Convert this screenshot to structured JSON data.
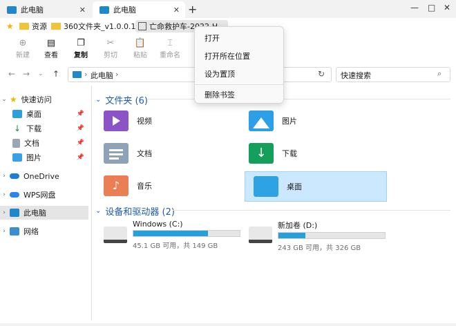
{
  "colors": {
    "accent": "#0067c0",
    "selection_bg": "#cce8ff",
    "drive_bar": "#26a0da",
    "section_text": "#1e5bb0"
  },
  "tabs": [
    {
      "label": "此电脑",
      "icon": "monitor-icon",
      "active": false
    },
    {
      "label": "此电脑",
      "icon": "monitor-icon",
      "active": true
    }
  ],
  "new_tab_label": "+",
  "window_controls": {
    "minimize": "—",
    "maximize": "□",
    "close": "✕"
  },
  "bookmarks": [
    {
      "label": "资源",
      "icon": "folder-icon"
    },
    {
      "label": "360文件夹_v1.0.0.1...",
      "icon": "folder-icon"
    },
    {
      "label": "亡命救护车-2022-H...",
      "icon": "video-file-icon"
    }
  ],
  "toolbar": {
    "new": "新建",
    "view": "查看",
    "copy": "复制",
    "cut": "剪切",
    "paste": "粘贴",
    "rename": "重命名"
  },
  "address": {
    "location": "此电脑",
    "separator": "›"
  },
  "search": {
    "placeholder": "快速搜索"
  },
  "sidebar": {
    "quick_access": "快速访问",
    "items": [
      {
        "label": "桌面",
        "icon": "desktop-icon"
      },
      {
        "label": "下载",
        "icon": "download-icon"
      },
      {
        "label": "文档",
        "icon": "document-icon"
      },
      {
        "label": "图片",
        "icon": "pictures-icon"
      }
    ],
    "onedrive": "OneDrive",
    "wps": "WPS网盘",
    "this_pc": "此电脑",
    "network": "网络"
  },
  "folders_section": "文件夹 (6)",
  "folders": [
    {
      "label": "视频",
      "icon": "videos-folder-icon",
      "selected": false
    },
    {
      "label": "图片",
      "icon": "pictures-folder-icon",
      "selected": false
    },
    {
      "label": "文档",
      "icon": "documents-folder-icon",
      "selected": false
    },
    {
      "label": "下载",
      "icon": "downloads-folder-icon",
      "selected": false
    },
    {
      "label": "音乐",
      "icon": "music-folder-icon",
      "selected": false
    },
    {
      "label": "桌面",
      "icon": "desktop-folder-icon",
      "selected": true
    }
  ],
  "drives_section": "设备和驱动器 (2)",
  "drives": [
    {
      "label": "Windows (C:)",
      "free": "45.1 GB 可用，共 149 GB",
      "used_fraction": 0.7
    },
    {
      "label": "新加卷 (D:)",
      "free": "243 GB 可用，共 326 GB",
      "used_fraction": 0.25
    }
  ],
  "context_menu": {
    "open": "打开",
    "open_location": "打开所在位置",
    "pin_top": "设为置顶",
    "delete_bookmark": "删除书签"
  }
}
